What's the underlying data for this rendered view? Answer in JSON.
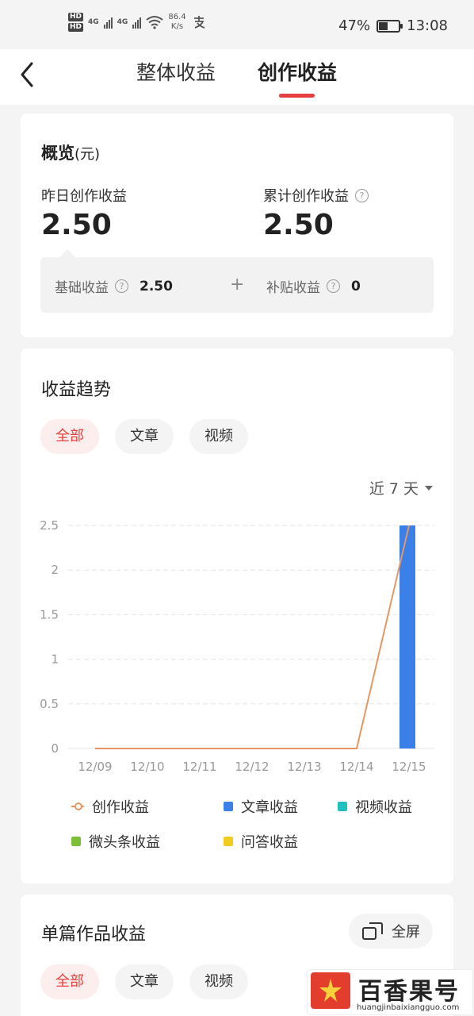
{
  "status": {
    "hd1": "HD",
    "hd2": "HD",
    "net1": "4G",
    "net2": "4G",
    "speed_value": "86.4",
    "speed_unit": "K/s",
    "battery": "47%",
    "battery_level": 0.47,
    "time": "13:08"
  },
  "header": {
    "tabs": [
      {
        "label": "整体收益"
      },
      {
        "label": "创作收益"
      }
    ]
  },
  "overview": {
    "title": "概览",
    "unit": "(元)",
    "yesterday_label": "昨日创作收益",
    "yesterday_value": "2.50",
    "total_label": "累计创作收益",
    "total_value": "2.50",
    "base_label": "基础收益",
    "base_value": "2.50",
    "plus": "+",
    "subsidy_label": "补贴收益",
    "subsidy_value": "0"
  },
  "trend": {
    "title": "收益趋势",
    "filters": [
      {
        "label": "全部"
      },
      {
        "label": "文章"
      },
      {
        "label": "视频"
      }
    ],
    "range_label": "近 7 天"
  },
  "chart_data": {
    "type": "bar",
    "categories": [
      "12/09",
      "12/10",
      "12/11",
      "12/12",
      "12/13",
      "12/14",
      "12/15"
    ],
    "ylim": [
      0,
      2.5
    ],
    "yticks": [
      "0",
      "0.5",
      "1",
      "1.5",
      "2",
      "2.5"
    ],
    "series": [
      {
        "name": "创作收益",
        "kind": "line",
        "color": "#e49764",
        "values": [
          0,
          0,
          0,
          0,
          0,
          0,
          2.5
        ]
      },
      {
        "name": "文章收益",
        "kind": "bar",
        "color": "#3b7fe8",
        "values": [
          0,
          0,
          0,
          0,
          0,
          0,
          2.5
        ]
      },
      {
        "name": "视频收益",
        "kind": "bar",
        "color": "#20c0c0",
        "values": [
          0,
          0,
          0,
          0,
          0,
          0,
          0
        ]
      },
      {
        "name": "微头条收益",
        "kind": "bar",
        "color": "#7dbf3a",
        "values": [
          0,
          0,
          0,
          0,
          0,
          0,
          0
        ]
      },
      {
        "name": "问答收益",
        "kind": "bar",
        "color": "#f2cc1c",
        "values": [
          0,
          0,
          0,
          0,
          0,
          0,
          0
        ]
      }
    ],
    "grid": true,
    "legend_position": "bottom"
  },
  "single": {
    "title": "单篇作品收益",
    "fullscreen_label": "全屏",
    "filters": [
      {
        "label": "全部"
      },
      {
        "label": "文章"
      },
      {
        "label": "视频"
      }
    ]
  },
  "watermark": {
    "brand": "百香果号",
    "url": "huangjinbaixiangguo.com"
  }
}
